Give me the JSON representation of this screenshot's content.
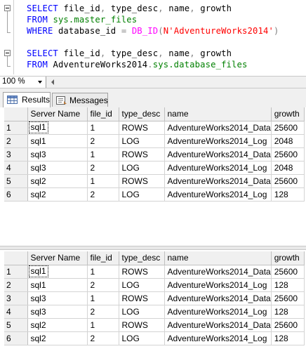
{
  "editor": {
    "query1": {
      "line1": {
        "kw": "SELECT",
        "cols": "file_id",
        "c1": ",",
        "col2": "type_desc",
        "c2": ",",
        "col3": "name",
        "c3": ",",
        "col4": "growth"
      },
      "line2": {
        "kw": "FROM",
        "obj": "sys.master_files"
      },
      "line3": {
        "kw": "WHERE",
        "col": "database_id",
        "op": "=",
        "fn": "DB_ID",
        "lp": "(",
        "str": "N'AdventureWorks2014'",
        "rp": ")"
      }
    },
    "query2": {
      "line1": {
        "kw": "SELECT",
        "cols": "file_id",
        "c1": ",",
        "col2": "type_desc",
        "c2": ",",
        "col3": "name",
        "c3": ",",
        "col4": "growth"
      },
      "line2": {
        "kw": "FROM",
        "db": "AdventureWorks2014",
        "dot": ".",
        "obj": "sys.database_files"
      }
    }
  },
  "zoom": {
    "value": "100 %"
  },
  "tabs": [
    {
      "label": "Results",
      "icon": "results-grid-icon",
      "active": true
    },
    {
      "label": "Messages",
      "icon": "messages-icon",
      "active": false
    }
  ],
  "grid1": {
    "columns": [
      "Server Name",
      "file_id",
      "type_desc",
      "name",
      "growth"
    ],
    "rows": [
      {
        "n": "1",
        "server": "sql1",
        "file_id": "1",
        "type_desc": "ROWS",
        "name": "AdventureWorks2014_Data",
        "growth": "25600"
      },
      {
        "n": "2",
        "server": "sql1",
        "file_id": "2",
        "type_desc": "LOG",
        "name": "AdventureWorks2014_Log",
        "growth": "2048"
      },
      {
        "n": "3",
        "server": "sql3",
        "file_id": "1",
        "type_desc": "ROWS",
        "name": "AdventureWorks2014_Data",
        "growth": "25600"
      },
      {
        "n": "4",
        "server": "sql3",
        "file_id": "2",
        "type_desc": "LOG",
        "name": "AdventureWorks2014_Log",
        "growth": "2048"
      },
      {
        "n": "5",
        "server": "sql2",
        "file_id": "1",
        "type_desc": "ROWS",
        "name": "AdventureWorks2014_Data",
        "growth": "25600"
      },
      {
        "n": "6",
        "server": "sql2",
        "file_id": "2",
        "type_desc": "LOG",
        "name": "AdventureWorks2014_Log",
        "growth": "128"
      }
    ]
  },
  "grid2": {
    "columns": [
      "Server Name",
      "file_id",
      "type_desc",
      "name",
      "growth"
    ],
    "rows": [
      {
        "n": "1",
        "server": "sql1",
        "file_id": "1",
        "type_desc": "ROWS",
        "name": "AdventureWorks2014_Data",
        "growth": "25600"
      },
      {
        "n": "2",
        "server": "sql1",
        "file_id": "2",
        "type_desc": "LOG",
        "name": "AdventureWorks2014_Log",
        "growth": "128"
      },
      {
        "n": "3",
        "server": "sql3",
        "file_id": "1",
        "type_desc": "ROWS",
        "name": "AdventureWorks2014_Data",
        "growth": "25600"
      },
      {
        "n": "4",
        "server": "sql3",
        "file_id": "2",
        "type_desc": "LOG",
        "name": "AdventureWorks2014_Log",
        "growth": "128"
      },
      {
        "n": "5",
        "server": "sql2",
        "file_id": "1",
        "type_desc": "ROWS",
        "name": "AdventureWorks2014_Data",
        "growth": "25600"
      },
      {
        "n": "6",
        "server": "sql2",
        "file_id": "2",
        "type_desc": "LOG",
        "name": "AdventureWorks2014_Log",
        "growth": "128"
      }
    ]
  }
}
